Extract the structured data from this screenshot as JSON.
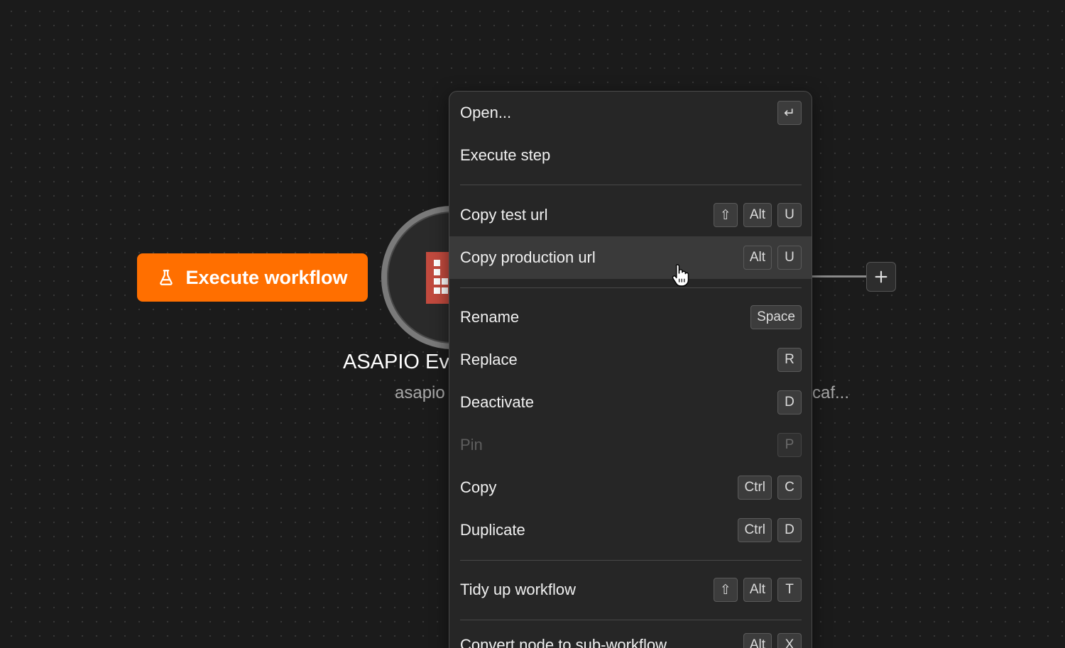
{
  "canvas": {
    "execute_button": {
      "label": "Execute workflow",
      "icon": "flask-icon"
    },
    "node": {
      "title": "ASAPIO Ev",
      "subtitle_left": "asapio",
      "subtitle_right": "caf..."
    },
    "add_button": {
      "icon": "plus-icon"
    }
  },
  "context_menu": {
    "items": [
      {
        "label": "Open...",
        "keys": [
          "↵"
        ]
      },
      {
        "label": "Execute step",
        "keys": []
      },
      {
        "label": "Copy test url",
        "keys": [
          "⇧",
          "Alt",
          "U"
        ]
      },
      {
        "label": "Copy production url",
        "keys": [
          "Alt",
          "U"
        ]
      },
      {
        "label": "Rename",
        "keys": [
          "Space"
        ]
      },
      {
        "label": "Replace",
        "keys": [
          "R"
        ]
      },
      {
        "label": "Deactivate",
        "keys": [
          "D"
        ]
      },
      {
        "label": "Pin",
        "keys": [
          "P"
        ]
      },
      {
        "label": "Copy",
        "keys": [
          "Ctrl",
          "C"
        ]
      },
      {
        "label": "Duplicate",
        "keys": [
          "Ctrl",
          "D"
        ]
      },
      {
        "label": "Tidy up workflow",
        "keys": [
          "⇧",
          "Alt",
          "T"
        ]
      },
      {
        "label": "Convert node to sub-workflow",
        "keys": [
          "Alt",
          "X"
        ]
      }
    ]
  },
  "colors": {
    "accent": "#ff6f00",
    "background": "#1b1b1b",
    "menu_background": "#262626",
    "menu_hover": "#3a3a3a",
    "node_logo": "#c24a3e"
  }
}
